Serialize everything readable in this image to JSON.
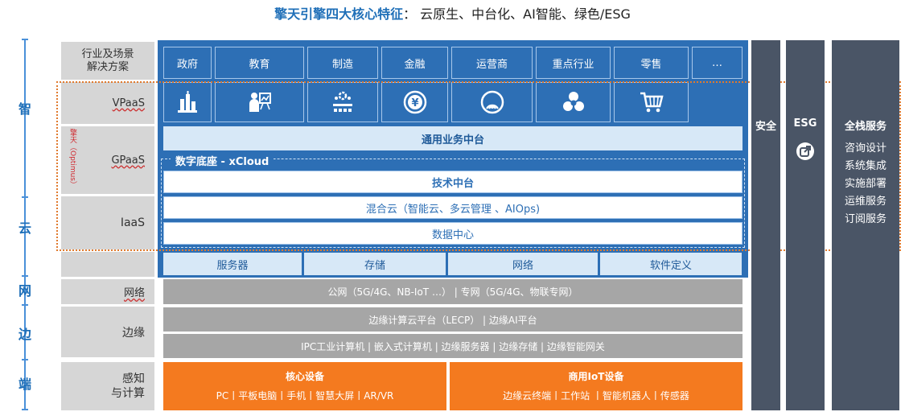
{
  "title": {
    "highlight": "擎天引擎四大核心特征",
    "rest": "： 云原生、中台化、AI智能、绿色/ESG"
  },
  "axis": {
    "zhi": "智",
    "yun": "云",
    "wang": "网",
    "bian": "边",
    "duan": "端"
  },
  "left_labels": {
    "industry": "行业及场景\n解决方案",
    "vpaas": "VPaaS",
    "gpaas": "GPaaS",
    "optimus": "擎天（Optimus）",
    "iaas": "IaaS",
    "network": "网络",
    "edge": "边缘",
    "sense": "感知\n与计算"
  },
  "industries": [
    "政府",
    "教育",
    "制造",
    "金融",
    "运营商",
    "重点行业",
    "零售",
    "…"
  ],
  "icons": [
    "building-icon",
    "teacher-icon",
    "factory-gear-icon",
    "yuan-coin-icon",
    "signal-tower-icon",
    "industry-hazard-icon",
    "shopping-cart-icon"
  ],
  "rows": {
    "general_middle": "通用业务中台",
    "xcloud": "数字底座 - xCloud",
    "tech_middle": "技术中台",
    "hybrid_cloud": "混合云（智能云、多云管理 、AIOps)",
    "datacenter": "数据中心",
    "infra": [
      "服务器",
      "存储",
      "网络",
      "软件定义"
    ],
    "network_row": "公网（5G/4G、NB-IoT …）  |  专网（5G/4G、物联专网）",
    "edge_row1": "边缘计算云平台（LECP） |  边缘AI平台",
    "edge_row2": "IPC工业计算机 | 嵌入式计算机 | 边缘服务器 | 边缘存储  | 边缘智能网关"
  },
  "devices": {
    "core_title": "核心设备",
    "core_items": "PC丨平板电脑丨手机丨智慧大屏丨AR/VR",
    "iot_title": "商用IoT设备",
    "iot_items": "边缘云终端丨工作站 丨智能机器人丨传感器"
  },
  "right": {
    "security": "安全",
    "esg": "ESG",
    "fullstack": "全栈服务",
    "services": [
      "咨询设计",
      "系统集成",
      "实施部署",
      "运维服务",
      "订阅服务"
    ]
  },
  "colors": {
    "primary_blue": "#2d6fb5",
    "light_blue": "#d7e8f7",
    "orange": "#f47a1f",
    "dark_slate": "#4a5566",
    "gray": "#a6a6a6"
  }
}
